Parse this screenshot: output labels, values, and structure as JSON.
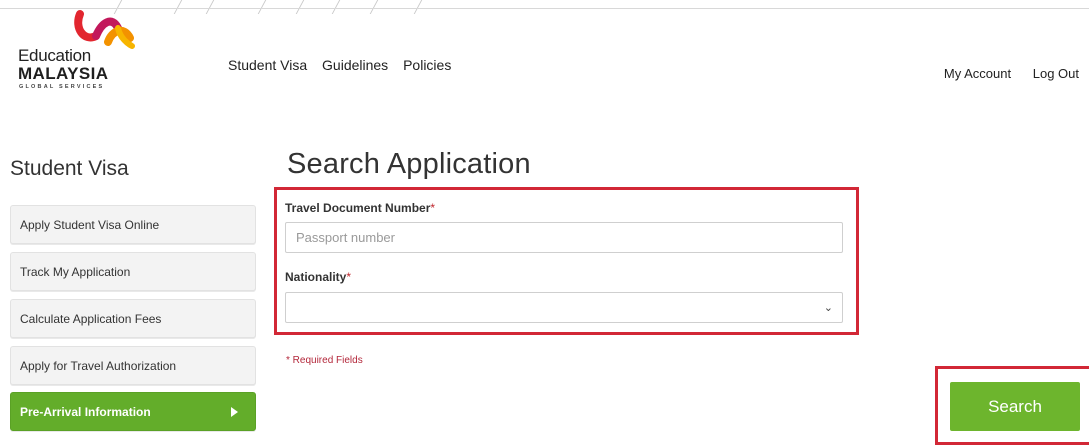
{
  "logo": {
    "line1": "Education",
    "line2": "MALAYSIA",
    "line3": "GLOBAL SERVICES"
  },
  "nav": [
    "Student Visa",
    "Guidelines",
    "Policies"
  ],
  "account": {
    "my_account": "My Account",
    "logout": "Log Out"
  },
  "sidebar": {
    "title": "Student Visa",
    "items": [
      {
        "label": "Apply Student Visa Online"
      },
      {
        "label": "Track My Application"
      },
      {
        "label": "Calculate Application Fees"
      },
      {
        "label": "Apply for Travel Authorization"
      },
      {
        "label": "Pre-Arrival Information",
        "active": true
      }
    ]
  },
  "main": {
    "title": "Search Application",
    "travel_doc_label": "Travel Document Number",
    "travel_doc_placeholder": "Passport number",
    "travel_doc_value": "",
    "nationality_label": "Nationality",
    "nationality_value": "",
    "required_marker": "*",
    "required_note": "* Required Fields",
    "search_label": "Search"
  },
  "colors": {
    "accent_green": "#6db52d",
    "highlight_red": "#d22836",
    "required_red": "#c0272d"
  },
  "icons": [
    "logo-mark-icon",
    "chevron-down-icon",
    "caret-right-icon"
  ]
}
